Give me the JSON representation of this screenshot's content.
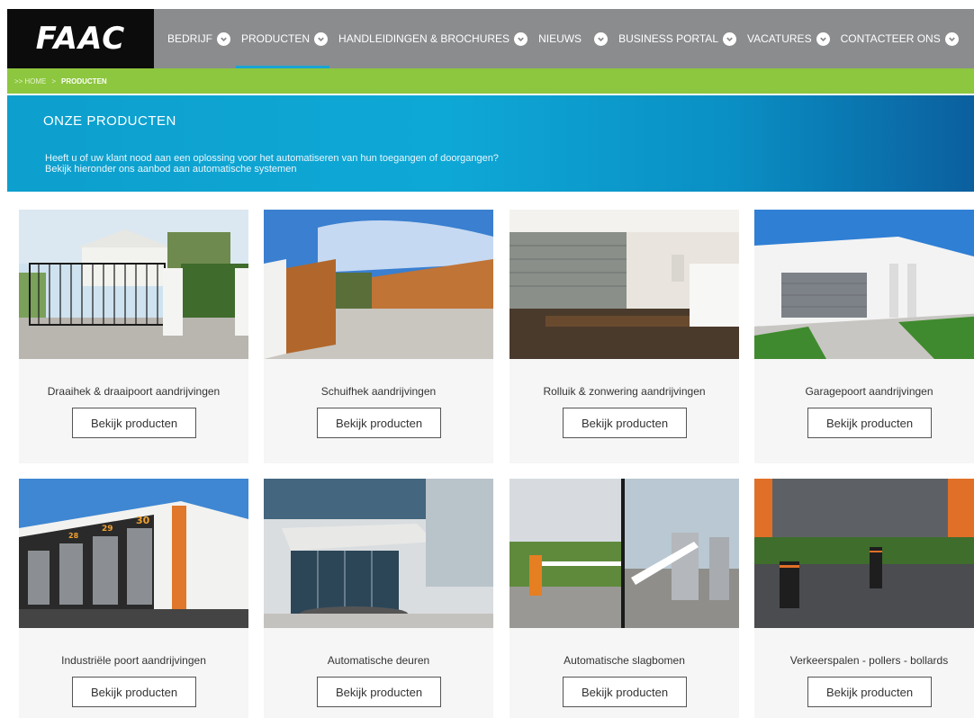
{
  "header": {
    "logo": "FAAC",
    "nav": [
      {
        "label": "BEDRIJF"
      },
      {
        "label": "PRODUCTEN",
        "active": true
      },
      {
        "label": "HANDLEIDINGEN & BROCHURES"
      },
      {
        "label": "NIEUWS"
      },
      {
        "label": "BUSINESS PORTAL"
      },
      {
        "label": "VACATURES"
      },
      {
        "label": "CONTACTEER ONS"
      }
    ]
  },
  "breadcrumb": {
    "prefix": ">>",
    "home": "HOME",
    "separator": ">",
    "current": "PRODUCTEN"
  },
  "hero": {
    "title": "ONZE PRODUCTEN",
    "line1": "Heeft u of uw klant nood aan een oplossing voor het automatiseren van hun toegangen of doorgangen?",
    "line2": "Bekijk hieronder ons aanbod aan automatische systemen"
  },
  "products": [
    {
      "title": "Draaihek & draaipoort aandrijvingen",
      "button": "Bekijk producten"
    },
    {
      "title": "Schuifhek aandrijvingen",
      "button": "Bekijk producten"
    },
    {
      "title": "Rolluik & zonwering aandrijvingen",
      "button": "Bekijk producten"
    },
    {
      "title": "Garagepoort aandrijvingen",
      "button": "Bekijk producten"
    },
    {
      "title": "Industriële poort aandrijvingen",
      "button": "Bekijk producten"
    },
    {
      "title": "Automatische deuren",
      "button": "Bekijk producten"
    },
    {
      "title": "Automatische slagbomen",
      "button": "Bekijk producten"
    },
    {
      "title": "Verkeerspalen - pollers - bollards",
      "button": "Bekijk producten"
    }
  ],
  "colors": {
    "nav_bg": "#8a8c8e",
    "logo_bg": "#0c0c0c",
    "breadcrumb_bg": "#8dc63f",
    "hero_bg": "#0ea8d6",
    "active_underline": "#1aa3d5"
  },
  "icons": {
    "nav_chevron": "chevron-down-circle-icon"
  }
}
